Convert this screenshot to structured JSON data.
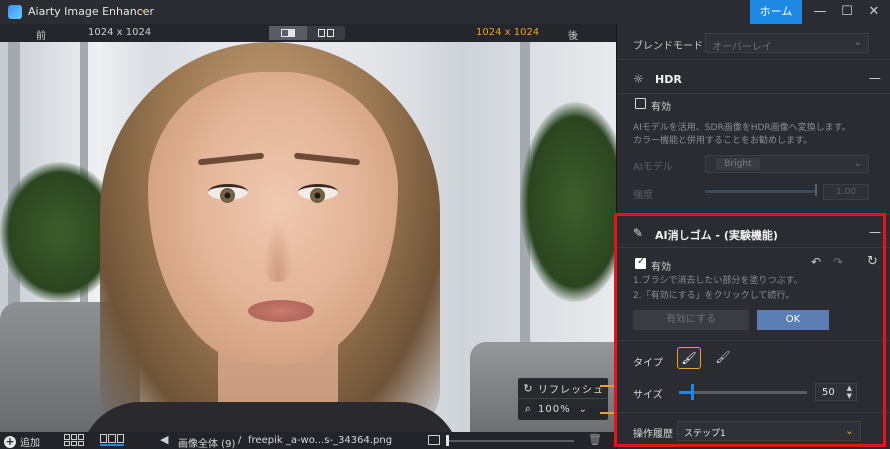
{
  "titlebar": {
    "app_name": "Aiarty Image Enhancer",
    "home_label": "ホーム",
    "minimize": "—",
    "maximize": "☐",
    "close": "✕"
  },
  "compare": {
    "before_label": "前",
    "before_size": "1024 x 1024",
    "after_size": "1024 x 1024",
    "after_label": "後"
  },
  "overlay": {
    "refresh_label": "リフレッシュ",
    "zoom_value": "100%"
  },
  "bottombar": {
    "add_label": "追加",
    "breadcrumb": "画像全体 (9)",
    "separator": "/",
    "filename": "freepik _a-wo...s-_34364.png"
  },
  "panel": {
    "blend": {
      "label": "ブレンドモード",
      "value": "オーバーレイ"
    },
    "hdr": {
      "title": "HDR",
      "enable_label": "有効",
      "enabled": false,
      "desc_1": "AIモデルを活用、SDR画像をHDR画像へ変換します。",
      "desc_2": "カラー機能と併用することをお勧めします。",
      "model_label": "AIモデル",
      "model_value": "Bright",
      "strength_label": "強度",
      "strength_value": "1.00"
    },
    "eraser": {
      "title": "AI消しゴム - (実験機能)",
      "enable_label": "有効",
      "enabled": true,
      "step_1": "1.ブラシで消去したい部分を塗りつぶす。",
      "step_2": "2.「有効にする」をクリックして続行。",
      "apply_label": "有効にする",
      "ok_label": "OK",
      "type_label": "タイプ",
      "size_label": "サイズ",
      "size_value": "50",
      "history_label": "操作履歴",
      "history_value": "ステップ1"
    }
  },
  "colors": {
    "accent_blue": "#1e88e5",
    "accent_orange": "#f0a020",
    "highlight_red": "#e5131a",
    "ok_button": "#5b7fb4"
  }
}
